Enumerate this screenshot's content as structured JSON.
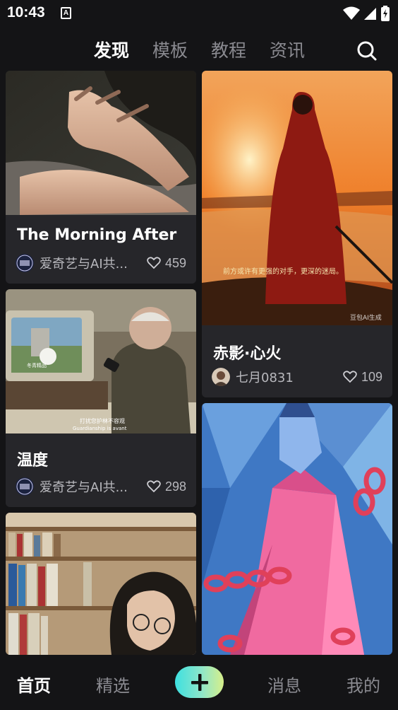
{
  "status": {
    "time": "10:43",
    "a_badge": "A"
  },
  "tabs": [
    {
      "label": "发现",
      "active": true
    },
    {
      "label": "模板",
      "active": false
    },
    {
      "label": "教程",
      "active": false
    },
    {
      "label": "资讯",
      "active": false
    }
  ],
  "cards": [
    {
      "title": "The Morning After",
      "author": "爱奇艺与AI共...",
      "likes": "459"
    },
    {
      "title": "赤影·心火",
      "author": "七月0831",
      "likes": "109",
      "image_caption": "前方或许有更强的对手，更深的迷局。",
      "watermark": "豆包AI生成"
    },
    {
      "title": "温度",
      "author": "爱奇艺与AI共...",
      "likes": "298",
      "subtitle_cn": "打扰您护林不容观",
      "subtitle_en": "Guardianship is avant",
      "tv_screen_text": "冬青精品"
    },
    {
      "title": "",
      "author": "",
      "likes": ""
    }
  ],
  "nav": [
    {
      "label": "首页",
      "active": true
    },
    {
      "label": "精选",
      "active": false
    },
    {
      "label": "+",
      "active": false
    },
    {
      "label": "消息",
      "active": false
    },
    {
      "label": "我的",
      "active": false
    }
  ],
  "colors": {
    "background": "#141416",
    "card": "#26262a",
    "accent_start": "#3de0e0",
    "accent_end": "#d7ef8a",
    "muted": "#8a8a90"
  }
}
